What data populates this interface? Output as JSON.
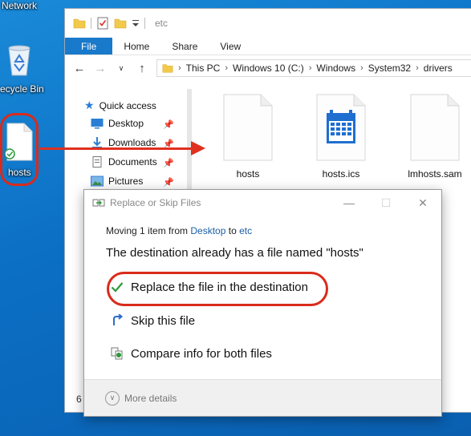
{
  "desktop": {
    "network_label": "Network",
    "recycle_bin_label": "ecycle Bin",
    "hosts_label": "hosts"
  },
  "explorer": {
    "title": "etc",
    "ribbon": {
      "file": "File",
      "home": "Home",
      "share": "Share",
      "view": "View"
    },
    "breadcrumb": [
      "This PC",
      "Windows 10 (C:)",
      "Windows",
      "System32",
      "drivers"
    ],
    "nav_pane": {
      "quick_access": "Quick access",
      "items": [
        "Desktop",
        "Downloads",
        "Documents",
        "Pictures"
      ]
    },
    "files": [
      "hosts",
      "hosts.ics",
      "lmhosts.sam"
    ],
    "status_count": "6"
  },
  "dialog": {
    "title": "Replace or Skip Files",
    "moving_prefix": "Moving 1 item from ",
    "from": "Desktop",
    "to_word": " to ",
    "to": "etc",
    "headline": "The destination already has a file named \"hosts\"",
    "options": {
      "replace": "Replace the file in the destination",
      "skip": "Skip this file",
      "compare": "Compare info for both files"
    },
    "more_details": "More details"
  },
  "colors": {
    "desktop_blue": "#0b6fc4",
    "ribbon_file_blue": "#1979ca",
    "highlight_red": "#d92b1b",
    "link_blue": "#1a5ea8",
    "check_green": "#2a9a3a"
  }
}
